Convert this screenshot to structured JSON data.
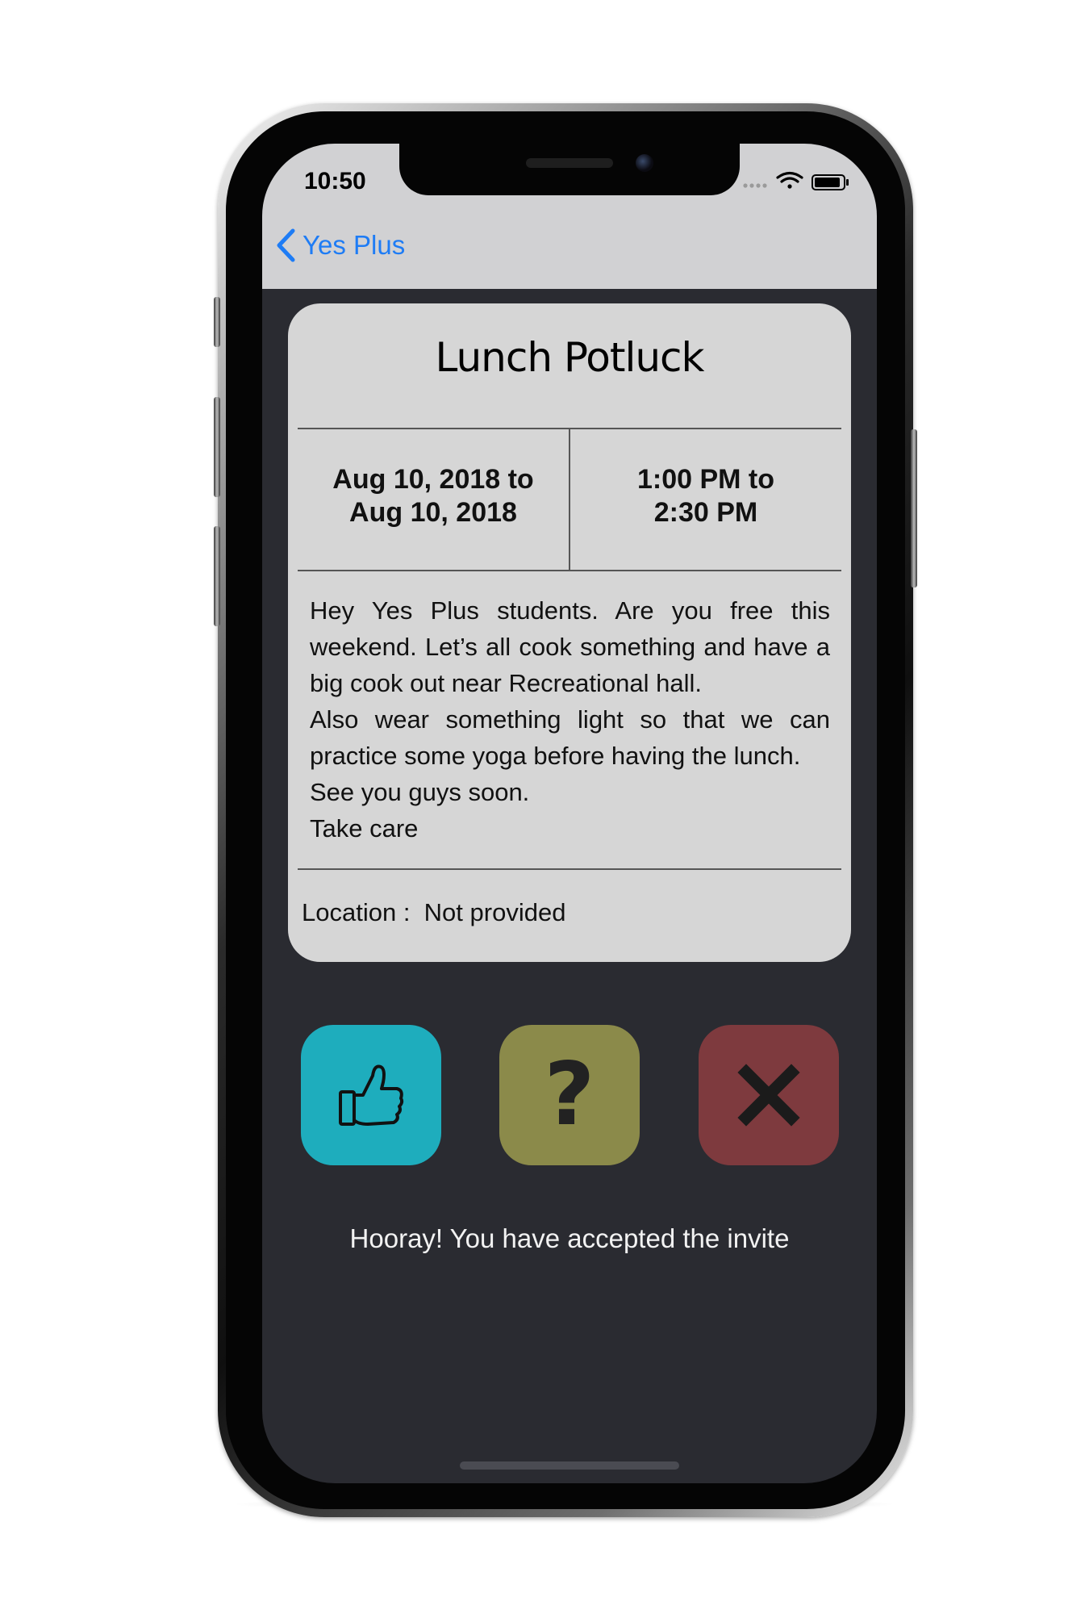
{
  "status_bar": {
    "time": "10:50",
    "icons": [
      "signal-dots-icon",
      "wifi-icon",
      "battery-icon"
    ]
  },
  "nav": {
    "back_label": "Yes Plus",
    "back_icon": "chevron-left-icon",
    "accent": "#1e7cf5"
  },
  "event": {
    "title": "Lunch Potluck",
    "date_line1": "Aug 10, 2018 to",
    "date_line2": "Aug 10, 2018",
    "time_line1": "1:00 PM to",
    "time_line2": "2:30 PM",
    "description_lines": [
      "Hey Yes Plus students. Are you free this weekend. Let’s all cook something and have a big cook out near Recreational hall.",
      "Also wear something light so that we can practice some yoga before having the lunch.",
      "See you guys soon.",
      "Take care"
    ],
    "location_label": "Location :",
    "location_value": "Not provided"
  },
  "responses": {
    "accept": {
      "icon": "thumbs-up-icon",
      "color": "#1eadbd"
    },
    "maybe": {
      "icon": "question-mark-icon",
      "glyph": "?",
      "color": "#8b8a4a"
    },
    "decline": {
      "icon": "x-icon",
      "color": "#7e3a3e"
    }
  },
  "status_message": "Hooray! You have accepted the invite"
}
